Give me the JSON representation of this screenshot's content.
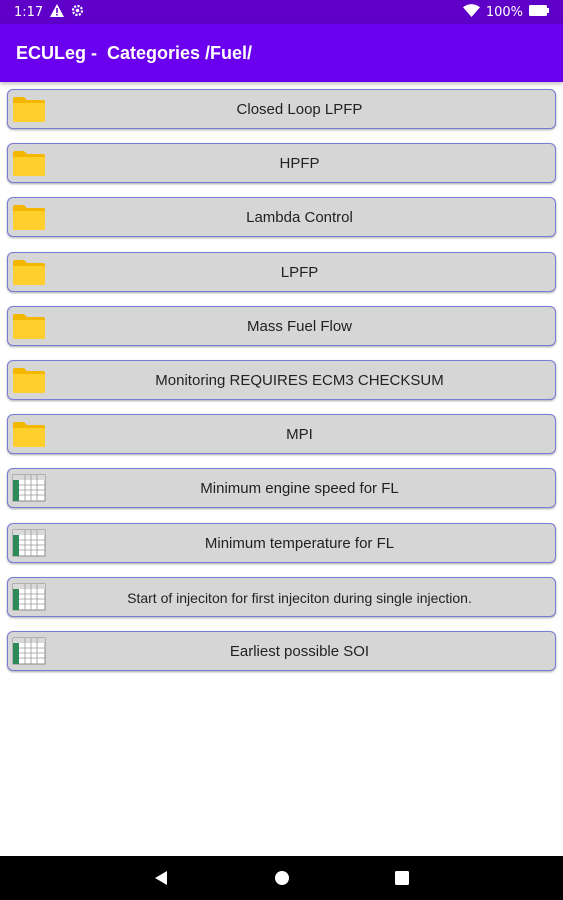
{
  "status_bar": {
    "time": "1:17",
    "battery": "100%",
    "icons": [
      "alert-icon",
      "settings-gear-icon",
      "wifi-icon",
      "battery-icon"
    ]
  },
  "app_bar": {
    "title": "ECULeg -  Categories /Fuel/",
    "color": "#6a00ee"
  },
  "items": [
    {
      "label": "Closed Loop LPFP",
      "icon": "folder-icon"
    },
    {
      "label": "HPFP",
      "icon": "folder-icon"
    },
    {
      "label": "Lambda Control",
      "icon": "folder-icon"
    },
    {
      "label": "LPFP",
      "icon": "folder-icon"
    },
    {
      "label": "Mass Fuel Flow",
      "icon": "folder-icon"
    },
    {
      "label": "Monitoring REQUIRES ECM3 CHECKSUM",
      "icon": "folder-icon"
    },
    {
      "label": "MPI",
      "icon": "folder-icon"
    },
    {
      "label": "Minimum engine speed for FL",
      "icon": "table-icon"
    },
    {
      "label": "Minimum temperature for FL",
      "icon": "table-icon"
    },
    {
      "label": "Start of injeciton for first injeciton during single injection.",
      "icon": "table-icon"
    },
    {
      "label": "Earliest possible SOI",
      "icon": "table-icon"
    }
  ],
  "nav_bar": {
    "buttons": [
      "back-icon",
      "home-icon",
      "recents-icon"
    ]
  }
}
